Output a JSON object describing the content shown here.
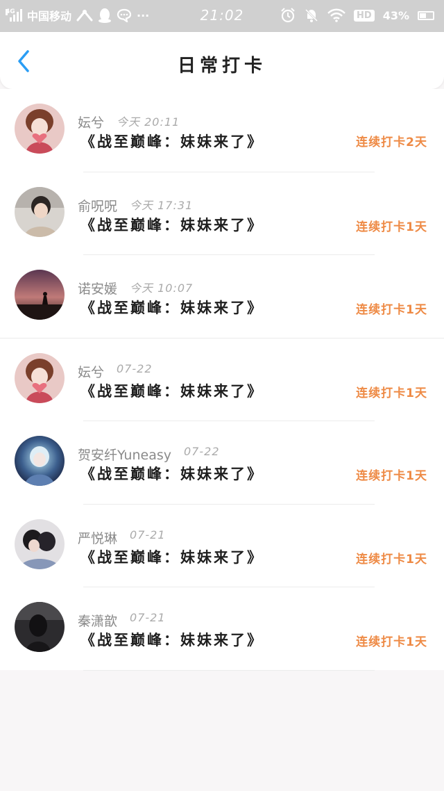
{
  "status_bar": {
    "network": "4G",
    "carrier": "中国移动",
    "more": "···",
    "time": "21:02",
    "hd": "HD",
    "battery": "43%"
  },
  "nav": {
    "title": "日常打卡"
  },
  "entries": [
    {
      "name": "妘兮",
      "time": "今天 20:11",
      "book": "《战至巅峰：妹妹来了》",
      "streak": "连续打卡2天"
    },
    {
      "name": "俞呪呪",
      "time": "今天 17:31",
      "book": "《战至巅峰：妹妹来了》",
      "streak": "连续打卡1天"
    },
    {
      "name": "诺安媛",
      "time": "今天 10:07",
      "book": "《战至巅峰：妹妹来了》",
      "streak": "连续打卡1天"
    },
    {
      "name": "妘兮",
      "time": "07-22",
      "book": "《战至巅峰：妹妹来了》",
      "streak": "连续打卡1天"
    },
    {
      "name": "贺安纤Yuneasy",
      "time": "07-22",
      "book": "《战至巅峰：妹妹来了》",
      "streak": "连续打卡1天"
    },
    {
      "name": "严悦琳",
      "time": "07-21",
      "book": "《战至巅峰：妹妹来了》",
      "streak": "连续打卡1天"
    },
    {
      "name": "秦潇歆",
      "time": "07-21",
      "book": "《战至巅峰：妹妹来了》",
      "streak": "连续打卡1天"
    }
  ],
  "colors": {
    "accent_back": "#2a9df4",
    "streak": "#ee8a45",
    "status_bar_bg": "#d0d0d0",
    "page_bg": "#f8f6f7"
  },
  "icons": {
    "back": "chevron-left-icon",
    "alarm": "alarm-icon",
    "mute": "bell-off-icon",
    "wifi": "wifi-icon",
    "battery": "battery-icon"
  }
}
